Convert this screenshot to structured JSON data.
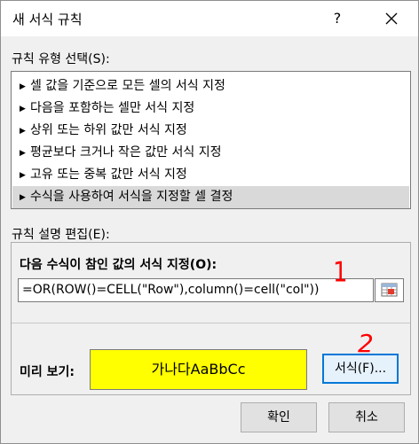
{
  "window": {
    "title": "새 서식 규칙",
    "help_label": "?"
  },
  "rule_type": {
    "label": "규칙 유형 선택(S):",
    "items": [
      {
        "label": "셀 값을 기준으로 모든 셀의 서식 지정",
        "selected": false
      },
      {
        "label": "다음을 포함하는 셀만 서식 지정",
        "selected": false
      },
      {
        "label": "상위 또는 하위 값만 서식 지정",
        "selected": false
      },
      {
        "label": "평균보다 크거나 작은 값만 서식 지정",
        "selected": false
      },
      {
        "label": "고유 또는 중복 값만 서식 지정",
        "selected": false
      },
      {
        "label": "수식을 사용하여 서식을 지정할 셀 결정",
        "selected": true
      }
    ],
    "arrow_glyph": "▶"
  },
  "rule_description": {
    "label": "규칙 설명 편집(E):",
    "formula_label": "다음 수식이 참인 값의 서식 지정(O):",
    "formula_value": "=OR(ROW()=CELL(\"Row\"),column()=cell(\"col\"))",
    "preview_label": "미리 보기:",
    "preview_text": "가나다AaBbCc",
    "preview_color": "#ffff00",
    "format_button": "서식(F)..."
  },
  "footer": {
    "ok_label": "확인",
    "cancel_label": "취소"
  },
  "annotations": {
    "mark1": "1",
    "mark2": "2",
    "color": "#ff0000"
  }
}
